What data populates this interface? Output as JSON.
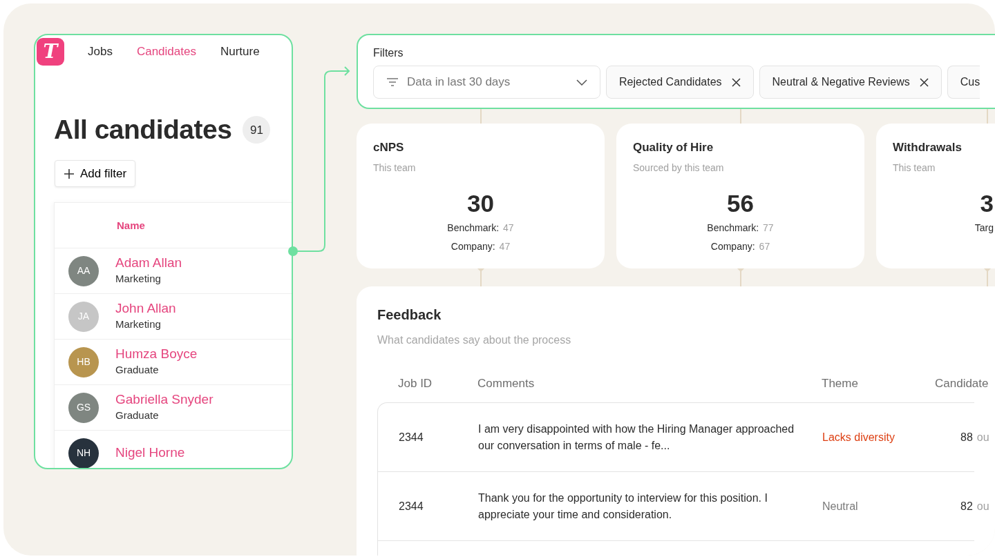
{
  "sidebar": {
    "logo": "T",
    "nav": [
      {
        "label": "Jobs",
        "selected": false
      },
      {
        "label": "Candidates",
        "selected": true
      },
      {
        "label": "Nurture",
        "selected": false
      }
    ],
    "title": "All candidates",
    "count": "91",
    "add_filter": "Add filter",
    "table": {
      "columns": [
        "Name"
      ],
      "rows": [
        {
          "initials": "AA",
          "name": "Adam Allan",
          "group": "Marketing",
          "color": "#7f8681"
        },
        {
          "initials": "JA",
          "name": "John Allan",
          "group": "Marketing",
          "color": "#c6c6c6"
        },
        {
          "initials": "HB",
          "name": "Humza Boyce",
          "group": "Graduate",
          "color": "#b8954f"
        },
        {
          "initials": "GS",
          "name": "Gabriella Snyder",
          "group": "Graduate",
          "color": "#7f8681"
        },
        {
          "initials": "NH",
          "name": "Nigel Horne",
          "color": "#27323d"
        }
      ]
    }
  },
  "filters": {
    "title": "Filters",
    "date_select": {
      "value": "Data in last 30 days"
    },
    "chips": [
      {
        "label": "Rejected Candidates",
        "removable": true
      },
      {
        "label": "Neutral & Negative Reviews",
        "removable": true
      },
      {
        "label": "Cus",
        "removable": false
      }
    ]
  },
  "metrics": [
    {
      "title": "cNPS",
      "subtitle": "This team",
      "value": "30",
      "stats": [
        {
          "label": "Benchmark:",
          "value": "47"
        },
        {
          "label": "Company:",
          "value": "47"
        }
      ]
    },
    {
      "title": "Quality of Hire",
      "subtitle": "Sourced by this team",
      "value": "56",
      "stats": [
        {
          "label": "Benchmark:",
          "value": "77"
        },
        {
          "label": "Company:",
          "value": "67"
        }
      ]
    },
    {
      "title": "Withdrawals",
      "subtitle": "This team",
      "value": "3",
      "stats": [
        {
          "label": "Targ"
        }
      ]
    }
  ],
  "feedback": {
    "title": "Feedback",
    "subtitle": "What candidates say about the process",
    "columns": [
      "Job ID",
      "Comments",
      "Theme",
      "Candidate"
    ],
    "rows": [
      {
        "job_id": "2344",
        "comment": "I am very disappointed with how the Hiring Manager approached our conversation in terms of male - fe...",
        "theme": "Lacks diversity",
        "color": "#dd3f12",
        "score": "88",
        "score_suffix": "ou"
      },
      {
        "job_id": "2344",
        "comment": "Thank you for the opportunity to interview for this position. I appreciate your time and consideration.",
        "theme": "Neutral",
        "color": "#7a7a7a",
        "score": "82",
        "score_suffix": "ou"
      }
    ]
  }
}
